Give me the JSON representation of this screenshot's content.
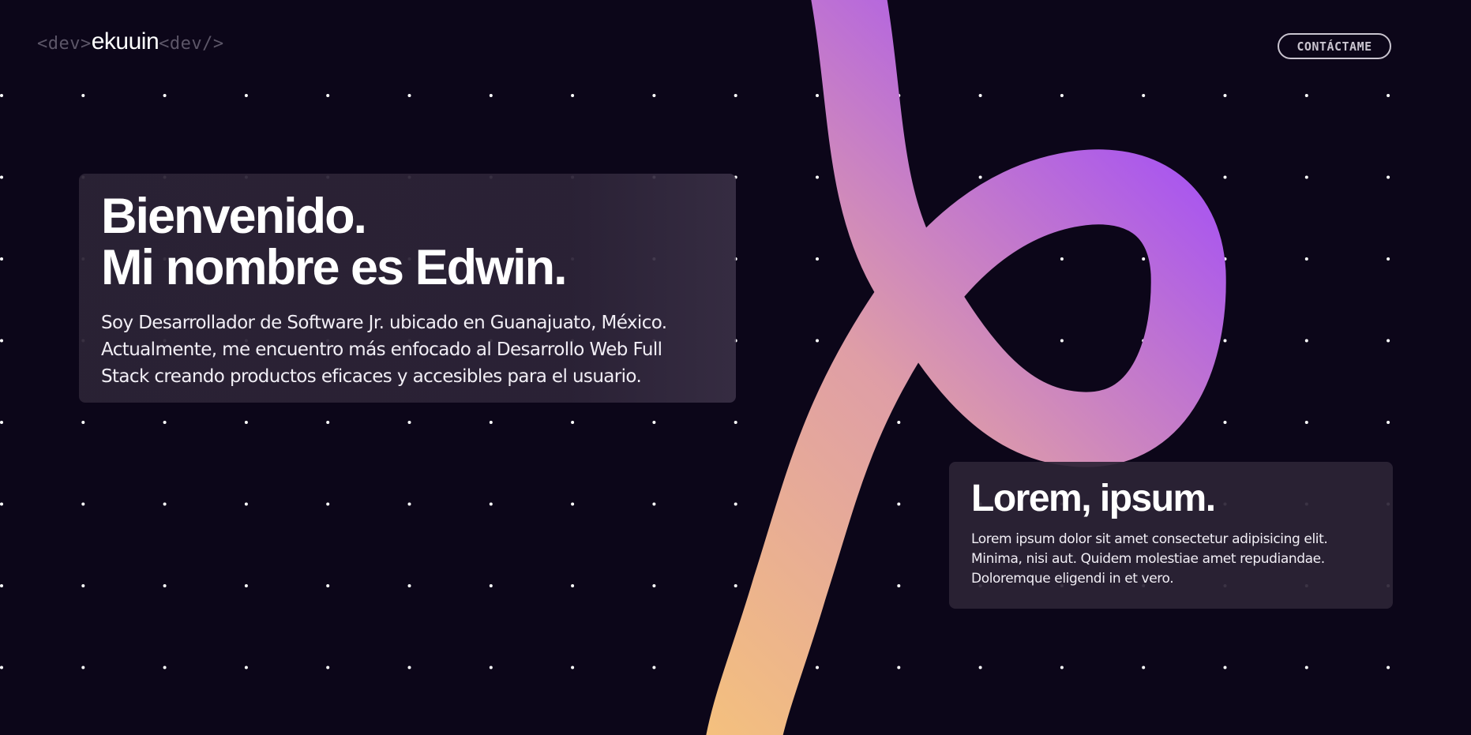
{
  "header": {
    "logo": {
      "open_tag": "<dev>",
      "name": "ekuuin",
      "close_tag": "<dev/>"
    },
    "contact_label": "CONTÁCTAME"
  },
  "hero": {
    "title_line1": "Bienvenido.",
    "title_line2": "Mi nombre es Edwin.",
    "description": "Soy Desarrollador de Software Jr. ubicado en Guanajuato, México. Actualmente, me encuentro más enfocado al Desarrollo Web Full Stack creando productos eficaces y accesibles para el usuario."
  },
  "secondary": {
    "title": "Lorem, ipsum.",
    "description": "Lorem ipsum dolor sit amet consectetur adipisicing elit. Minima, nisi aut. Quidem molestiae amet repudiandae. Doloremque eligendi in et vero."
  },
  "colors": {
    "background": "#0c0619",
    "ribbon_start": "#f4c07e",
    "ribbon_mid": "#df9ea6",
    "ribbon_end": "#a855f0",
    "card": "#2b2336",
    "dot": "#ffffff"
  }
}
